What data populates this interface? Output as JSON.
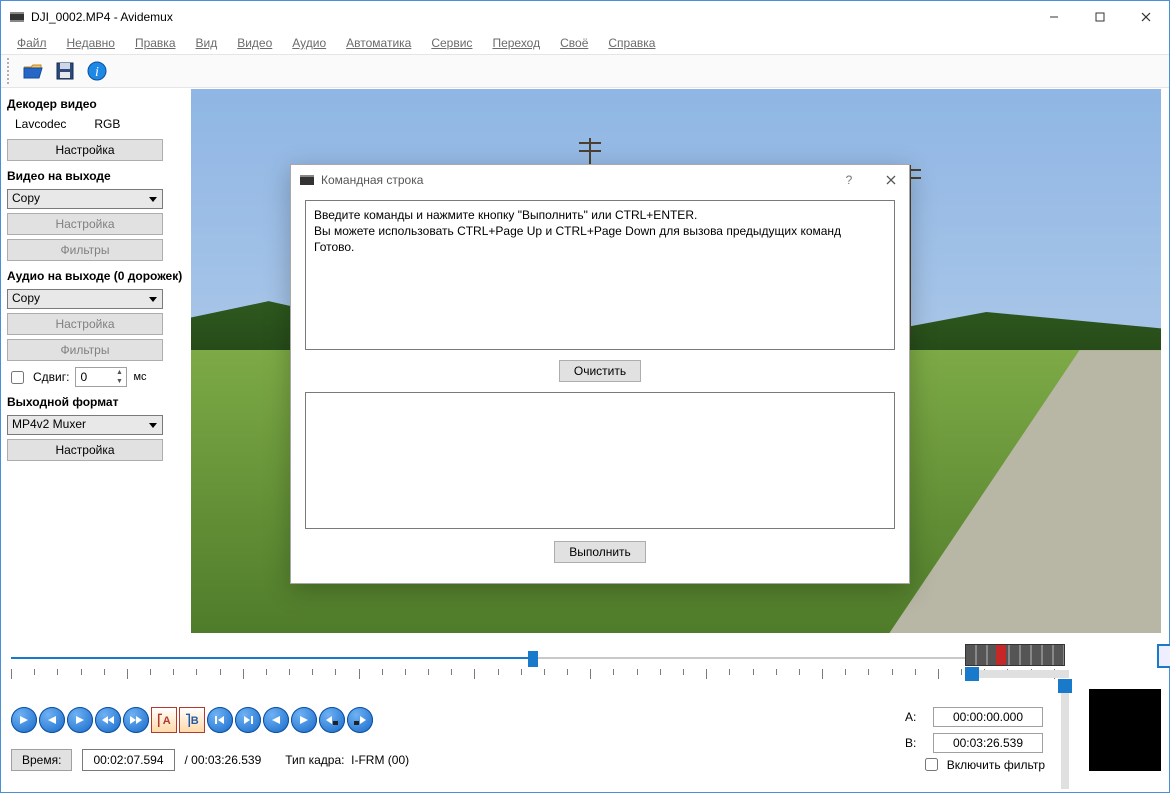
{
  "window": {
    "title": "DJI_0002.MP4 - Avidemux"
  },
  "menus": [
    "Файл",
    "Недавно",
    "Правка",
    "Вид",
    "Видео",
    "Аудио",
    "Автоматика",
    "Сервис",
    "Переход",
    "Своё",
    "Справка"
  ],
  "left": {
    "decoder_title": "Декодер видео",
    "decoder_codec": "Lavcodec",
    "decoder_colorspace": "RGB",
    "configure": "Настройка",
    "video_out_title": "Видео на выходе",
    "video_out_mode": "Copy",
    "filters": "Фильтры",
    "audio_out_title": "Аудио на выходе (0 дорожек)",
    "audio_out_mode": "Copy",
    "shift_label": "Сдвиг:",
    "shift_value": "0",
    "shift_unit": "мс",
    "output_fmt_title": "Выходной формат",
    "output_fmt": "MP4v2 Muxer"
  },
  "timeline": {
    "a_label": "A:",
    "a_time": "00:00:00.000",
    "b_label": "B:",
    "b_time": "00:03:26.539",
    "filter_chk": "Включить фильтр",
    "time_label": "Время:",
    "time_current": "00:02:07.594",
    "time_total": "/ 00:03:26.539",
    "frame_type_label": "Тип кадра:",
    "frame_type": "I-FRM (00)"
  },
  "dialog": {
    "title": "Командная строка",
    "log_line1": "Введите команды и нажмите кнопку \"Выполнить\" или CTRL+ENTER.",
    "log_line2": "Вы можете использовать CTRL+Page Up и CTRL+Page Down для вызова предыдущих команд",
    "log_line3": "Готово.",
    "clear": "Очистить",
    "run": "Выполнить"
  }
}
